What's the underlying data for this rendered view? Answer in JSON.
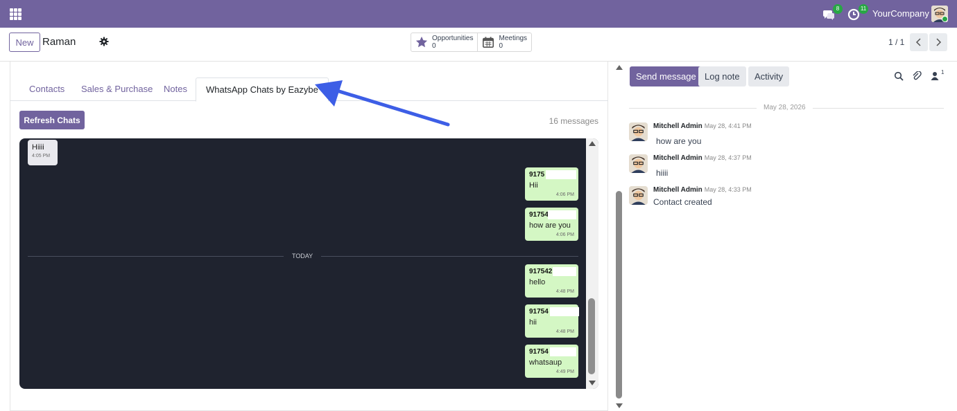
{
  "navbar": {
    "messages_badge": "8",
    "activities_badge": "11",
    "company": "YourCompany",
    "brand_color": "#71639e"
  },
  "control": {
    "new_label": "New",
    "record_name": "Raman",
    "smart_buttons": [
      {
        "label": "Opportunities",
        "count": "0",
        "icon": "star-icon"
      },
      {
        "label": "Meetings",
        "count": "0",
        "icon": "calendar-icon"
      }
    ],
    "pager": "1 / 1"
  },
  "tabs": [
    "Contacts",
    "Sales & Purchase",
    "Notes",
    "WhatsApp Chats by Eazybe"
  ],
  "whatsapp": {
    "refresh_label": "Refresh Chats",
    "count_label": "16 messages",
    "incoming": {
      "text": "Hiiii",
      "time": "4:05 PM"
    },
    "divider_label": "TODAY",
    "outgoing": [
      {
        "sender": "9175",
        "text": "Hii",
        "time": "4:06 PM"
      },
      {
        "sender": "91754",
        "text": "how are you",
        "time": "4:06 PM"
      },
      {
        "sender": "917542",
        "text": "hello",
        "time": "4:48 PM"
      },
      {
        "sender": "91754",
        "text": "hii",
        "time": "4:48 PM"
      },
      {
        "sender": "91754",
        "text": "whatsaup",
        "time": "4:49 PM"
      }
    ]
  },
  "chatter": {
    "send_label": "Send message",
    "log_label": "Log note",
    "activity_label": "Activity",
    "followers": "1",
    "date_separator": "May 28, 2026",
    "messages": [
      {
        "author": "Mitchell Admin",
        "date": "May 28, 4:41 PM",
        "body": "how are you"
      },
      {
        "author": "Mitchell Admin",
        "date": "May 28, 4:37 PM",
        "body": "hiiii"
      },
      {
        "author": "Mitchell Admin",
        "date": "May 28, 4:33 PM",
        "body": "Contact created"
      }
    ]
  }
}
